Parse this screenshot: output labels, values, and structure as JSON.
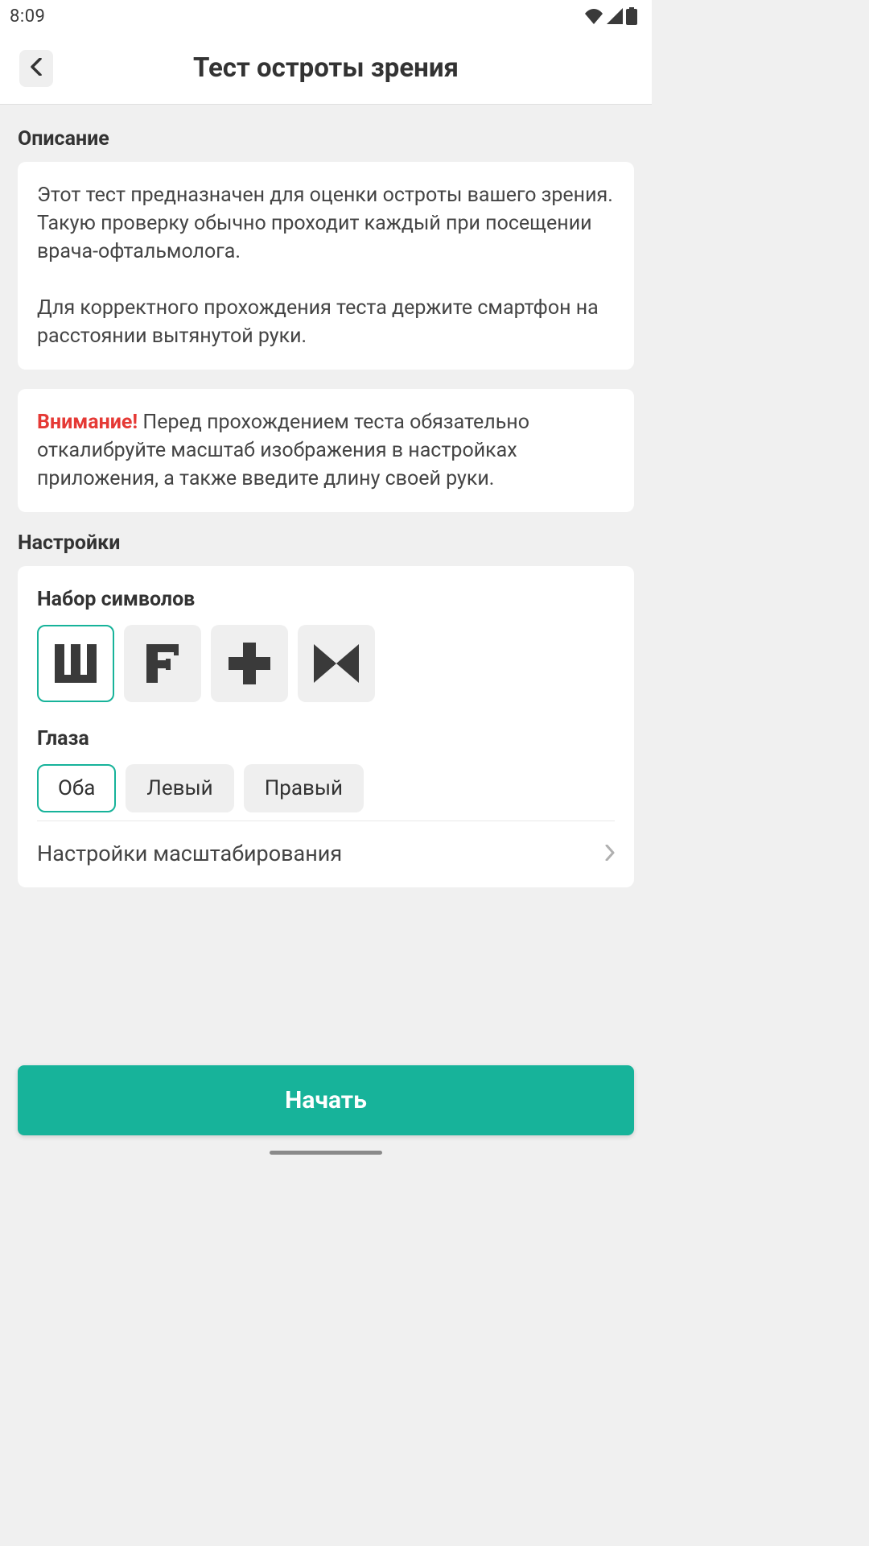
{
  "status": {
    "time": "8:09"
  },
  "header": {
    "title": "Тест остроты зрения"
  },
  "description": {
    "label": "Описание",
    "paragraph1": "Этот тест предназначен для оценки остроты вашего зрения. Такую проверку обычно проходит каждый при посещении врача-офтальмолога.",
    "paragraph2": "Для корректного прохождения теста держите смартфон на расстоянии вытянутой руки.",
    "warning_strong": "Внимание!",
    "warning_text": " Перед прохождением теста обязательно откалибруйте масштаб изображения в настройках приложения, а также введите длину своей руки."
  },
  "settings": {
    "label": "Настройки",
    "symbols_label": "Набор символов",
    "symbols_options": [
      {
        "name": "cyrillic-sh",
        "selected": true
      },
      {
        "name": "letter-f",
        "selected": false
      },
      {
        "name": "plus-cross",
        "selected": false
      },
      {
        "name": "tumbling-e",
        "selected": false
      }
    ],
    "eyes_label": "Глаза",
    "eyes_options": [
      {
        "label": "Оба",
        "selected": true
      },
      {
        "label": "Левый",
        "selected": false
      },
      {
        "label": "Правый",
        "selected": false
      }
    ],
    "scaling_link": "Настройки масштабирования"
  },
  "start_button": "Начать",
  "colors": {
    "accent": "#17b39a",
    "warning": "#e53935"
  }
}
